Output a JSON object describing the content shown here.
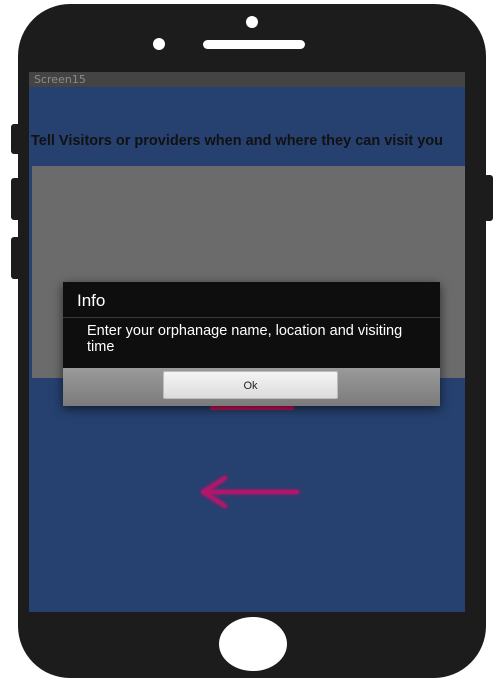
{
  "statusbar": {
    "title": "Screen15"
  },
  "screen": {
    "heading": "Tell Visitors or providers when and where they can visit you"
  },
  "dialog": {
    "title": "Info",
    "message": "Enter your orphanage name, location and visiting time",
    "ok_label": "Ok"
  },
  "icons": {
    "back": "back-arrow-icon",
    "home": "home-button"
  },
  "colors": {
    "screen_bg": "#264170",
    "accent": "#c8125a",
    "dialog_bg": "#0e0e0e"
  }
}
